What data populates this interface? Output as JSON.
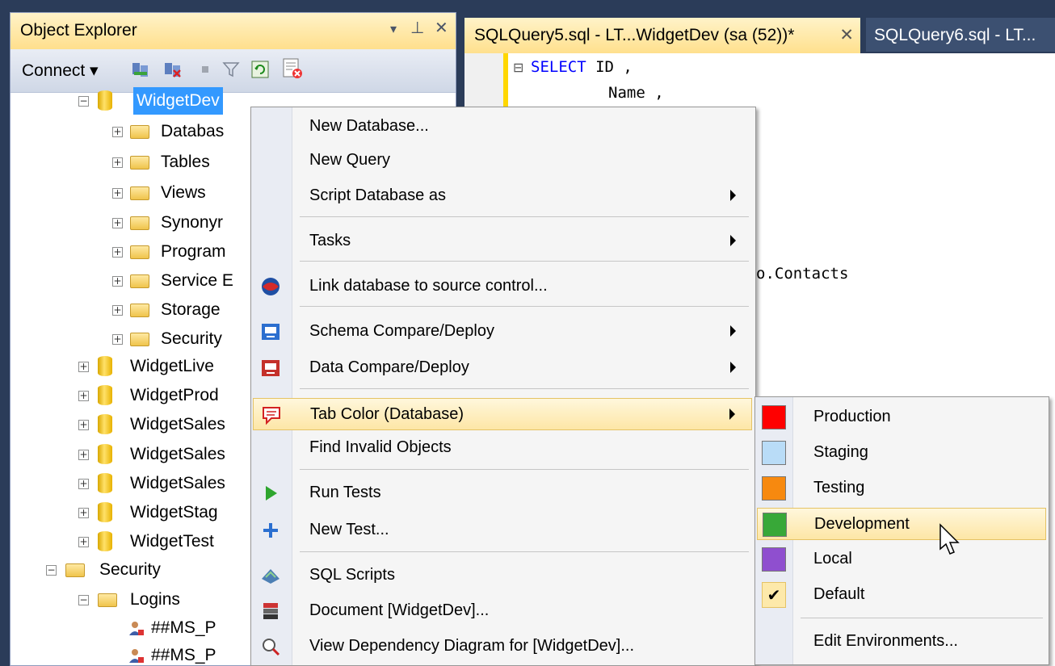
{
  "object_explorer": {
    "title": "Object Explorer",
    "pin_glyph": "⊥",
    "dropdown_glyph": "▾",
    "close_glyph": "✕",
    "toolbar": {
      "connect_label": "Connect ▾"
    },
    "tree": [
      {
        "id": "widgetdev",
        "label": "WidgetDev",
        "type": "database",
        "expanded": true,
        "selected": true
      },
      {
        "id": "databas",
        "label": "Databas",
        "type": "folder"
      },
      {
        "id": "tables",
        "label": "Tables",
        "type": "folder"
      },
      {
        "id": "views",
        "label": "Views",
        "type": "folder"
      },
      {
        "id": "synonyms",
        "label": "Synonyr",
        "type": "folder"
      },
      {
        "id": "programmability",
        "label": "Program",
        "type": "folder"
      },
      {
        "id": "service-broker",
        "label": "Service E",
        "type": "folder"
      },
      {
        "id": "storage",
        "label": "Storage",
        "type": "folder"
      },
      {
        "id": "security-db",
        "label": "Security",
        "type": "folder"
      },
      {
        "id": "widgetlive",
        "label": "WidgetLive",
        "type": "database"
      },
      {
        "id": "widgetprod",
        "label": "WidgetProd",
        "type": "database"
      },
      {
        "id": "widgetsales1",
        "label": "WidgetSales",
        "type": "database"
      },
      {
        "id": "widgetsales2",
        "label": "WidgetSales",
        "type": "database"
      },
      {
        "id": "widgetsales3",
        "label": "WidgetSales",
        "type": "database"
      },
      {
        "id": "widgetstag",
        "label": "WidgetStag",
        "type": "database"
      },
      {
        "id": "widgettest",
        "label": "WidgetTest",
        "type": "database"
      },
      {
        "id": "security",
        "label": "Security",
        "type": "folder",
        "expanded": true
      },
      {
        "id": "logins",
        "label": "Logins",
        "type": "folder",
        "expanded": true
      },
      {
        "id": "login1",
        "label": "##MS_P",
        "type": "user"
      },
      {
        "id": "login2",
        "label": "##MS_P",
        "type": "user"
      }
    ]
  },
  "editor": {
    "tab_active": "SQLQuery5.sql - LT...WidgetDev (sa (52))*",
    "tab_close_glyph": "✕",
    "tab_other": "SQLQuery6.sql - LT...",
    "collapse_glyph": "⊟",
    "code_lines": {
      "select_kw": "SELECT",
      "line1_rest": " ID ,",
      "line2": "Name ,",
      "fragment": "o.Contacts"
    }
  },
  "context_menu": {
    "items": [
      {
        "id": "new-database",
        "label": "New Database..."
      },
      {
        "id": "new-query",
        "label": "New Query"
      },
      {
        "id": "script-database-as",
        "label": "Script Database as",
        "submenu": true
      },
      {
        "id": "tasks",
        "label": "Tasks",
        "submenu": true
      },
      {
        "id": "link-source-control",
        "label": "Link database to source control...",
        "icon": "source-control-icon"
      },
      {
        "id": "schema-compare",
        "label": "Schema Compare/Deploy",
        "submenu": true,
        "icon": "schema-compare-icon"
      },
      {
        "id": "data-compare",
        "label": "Data Compare/Deploy",
        "submenu": true,
        "icon": "data-compare-icon"
      },
      {
        "id": "tab-color",
        "label": "Tab Color (Database)",
        "submenu": true,
        "highlighted": true,
        "icon": "tab-color-icon"
      },
      {
        "id": "find-invalid-objects",
        "label": "Find Invalid Objects"
      },
      {
        "id": "run-tests",
        "label": "Run Tests",
        "icon": "play-icon"
      },
      {
        "id": "new-test",
        "label": "New Test...",
        "icon": "plus-icon"
      },
      {
        "id": "sql-scripts",
        "label": "SQL Scripts",
        "icon": "sql-scripts-icon"
      },
      {
        "id": "document",
        "label": "Document [WidgetDev]...",
        "icon": "document-icon"
      },
      {
        "id": "dependency-diagram",
        "label": "View Dependency Diagram for [WidgetDev]...",
        "icon": "dependency-icon"
      }
    ],
    "glyphs": {
      "play": "▶",
      "plus": "✚"
    }
  },
  "tab_color_submenu": {
    "items": [
      {
        "id": "production",
        "label": "Production",
        "color": "#ff0000"
      },
      {
        "id": "staging",
        "label": "Staging",
        "color": "#b9dcf7"
      },
      {
        "id": "testing",
        "label": "Testing",
        "color": "#f7890f"
      },
      {
        "id": "development",
        "label": "Development",
        "color": "#38a838",
        "highlighted": true
      },
      {
        "id": "local",
        "label": "Local",
        "color": "#8f4fcf"
      },
      {
        "id": "default",
        "label": "Default",
        "checked": true
      },
      {
        "id": "edit-environments",
        "label": "Edit Environments..."
      }
    ],
    "check_glyph": "✔"
  },
  "colors": {
    "accent_highlight": "#fde6a6",
    "selection": "#3399ff",
    "chrome_dark": "#2b3c59"
  }
}
